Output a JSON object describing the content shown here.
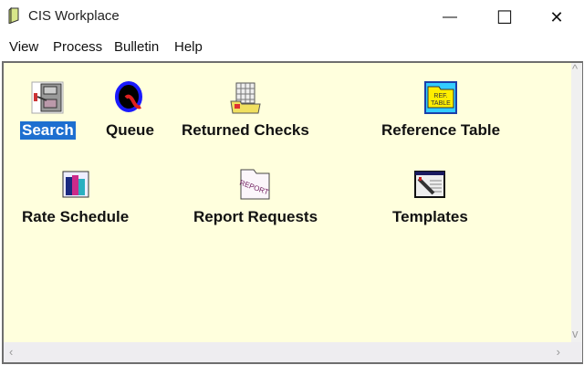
{
  "window": {
    "title": "CIS Workplace",
    "minimize": "—",
    "maximize": "☐",
    "close": "✕"
  },
  "menu": [
    "View",
    "Process",
    "Bulletin",
    "Help"
  ],
  "items": [
    {
      "label": "Search",
      "icon": "file-cabinet-icon",
      "selected": true
    },
    {
      "label": "Queue",
      "icon": "queue-q-icon"
    },
    {
      "label": "Returned Checks",
      "icon": "folder-grid-icon"
    },
    {
      "label": "Reference Table",
      "icon": "ref-table-icon",
      "icon_text": "REF. TABLE"
    },
    {
      "label": "Rate Schedule",
      "icon": "binders-icon"
    },
    {
      "label": "Report Requests",
      "icon": "report-folder-icon",
      "icon_text": "REPORT"
    },
    {
      "label": "Templates",
      "icon": "template-pencil-icon"
    }
  ],
  "colors": {
    "background": "#ffffdd",
    "selection": "#1e6fd0"
  }
}
